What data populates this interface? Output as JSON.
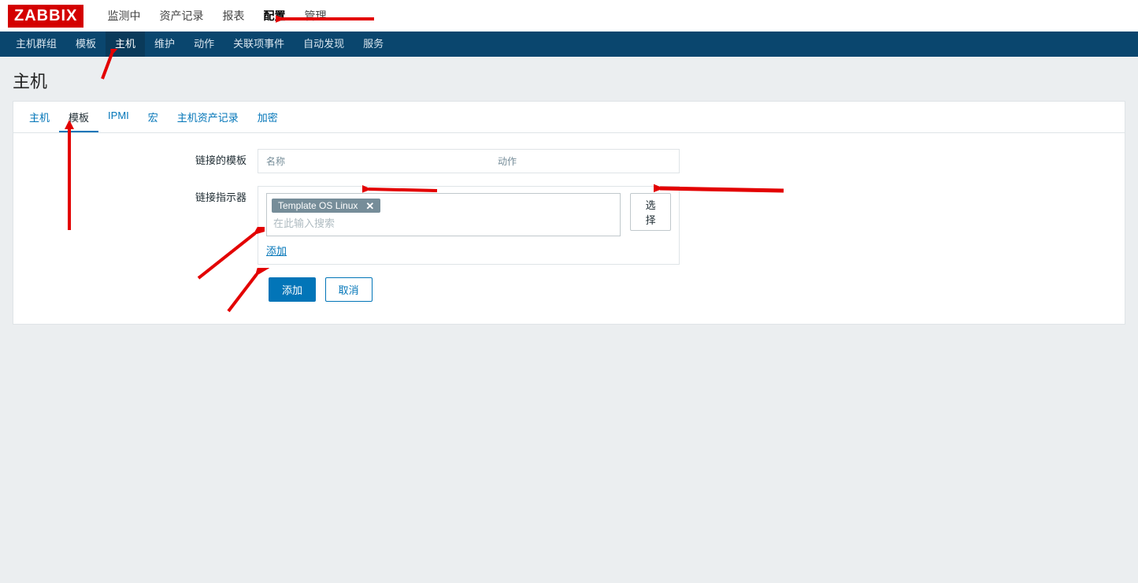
{
  "logo": "ZABBIX",
  "top_nav": {
    "items": [
      {
        "label": "监测中"
      },
      {
        "label": "资产记录"
      },
      {
        "label": "报表"
      },
      {
        "label": "配置",
        "active": true
      },
      {
        "label": "管理"
      }
    ]
  },
  "sub_nav": {
    "items": [
      {
        "label": "主机群组"
      },
      {
        "label": "模板"
      },
      {
        "label": "主机",
        "active": true
      },
      {
        "label": "维护"
      },
      {
        "label": "动作"
      },
      {
        "label": "关联项事件"
      },
      {
        "label": "自动发现"
      },
      {
        "label": "服务"
      }
    ]
  },
  "page_title": "主机",
  "form_tabs": [
    {
      "label": "主机"
    },
    {
      "label": "模板",
      "active": true
    },
    {
      "label": "IPMI"
    },
    {
      "label": "宏"
    },
    {
      "label": "主机资产记录"
    },
    {
      "label": "加密"
    }
  ],
  "linked_templates": {
    "label": "链接的模板",
    "th_name": "名称",
    "th_action": "动作"
  },
  "link_indicators": {
    "label": "链接指示器",
    "chip": "Template OS Linux",
    "placeholder": "在此输入搜索",
    "select_btn": "选择",
    "add_link": "添加"
  },
  "actions": {
    "add": "添加",
    "cancel": "取消"
  }
}
